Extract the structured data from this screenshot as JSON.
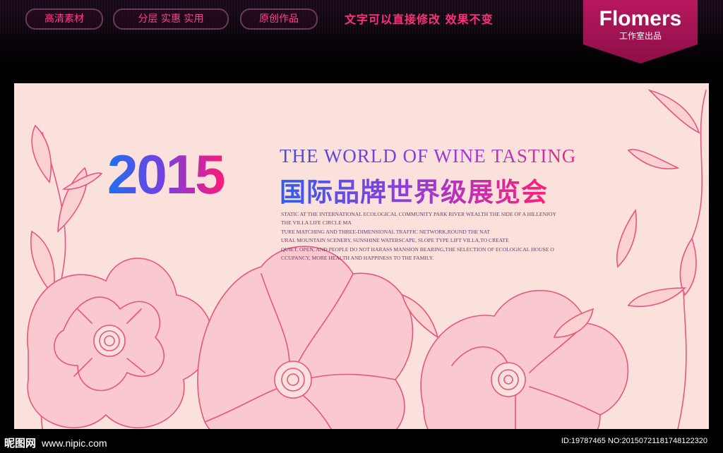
{
  "header": {
    "tags": [
      "高清素材",
      "分层 实惠 实用",
      "原创作品"
    ],
    "slogan": "文字可以直接修改  效果不变",
    "brand": {
      "name": "Flomers",
      "subtitle": "工作室出品"
    }
  },
  "poster": {
    "year": "2015",
    "english_title": "THE WORLD OF WINE TASTING",
    "chinese_title": "国际品牌世界级展览会",
    "body_lines": [
      "STATIC AT THE INTERNATIONAL ECOLOGICAL COMMUNITY PARK RIVER WEALTH THE SIDE OF A HILLENJOY",
      "THE VILLA LIFE CIRCLE MA",
      "TURE MATCHING AND THREE-DIMENSIONAL TRAFFIC NETWORK,ROUND THE NAT",
      "URAL MOUNTAIN SCENERY, SUNSHINE WATERSCAPE, SLOPE TYPE LIFT VILLA,TO CREATE",
      "QUIET, OPEN, AND PEOPLE DO NOT HARASS MANSION BEARING,THE SELECTION OF ECOLOGICAL HOUSE O",
      "CCUPANCY, MORE HEALTH AND HAPPINESS TO THE FAMILY."
    ],
    "colors": {
      "background": "#fbe1db",
      "line_art": "#e8557f",
      "accent_blue": "#1e6ff0",
      "accent_pink": "#ff1a77"
    }
  },
  "watermark": {
    "site": "昵图网",
    "url": "www.nipic.com",
    "id_text": "ID:19787465 NO:20150721181748122320"
  }
}
